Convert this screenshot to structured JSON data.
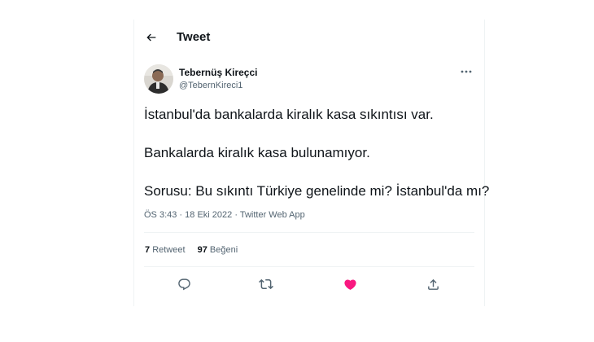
{
  "header": {
    "title": "Tweet",
    "back_icon": "arrow-left-icon"
  },
  "author": {
    "name": "Tebernüş Kireçci",
    "handle": "@TebernKireci1",
    "avatar": "profile-photo"
  },
  "tweet": {
    "lines": [
      "İstanbul'da bankalarda kiralık kasa sıkıntısı var.",
      "Bankalarda kiralık kasa bulunamıyor.",
      "Sorusu: Bu sıkıntı Türkiye genelinde mi? İstanbul'da mı?"
    ],
    "time": "ÖS 3:43",
    "separator": "·",
    "date": "18 Eki 2022",
    "source": "Twitter Web App"
  },
  "stats": {
    "retweets_count": "7",
    "retweets_label": "Retweet",
    "likes_count": "97",
    "likes_label": "Beğeni"
  },
  "actions": {
    "reply_icon": "reply-icon",
    "retweet_icon": "retweet-icon",
    "like_icon": "heart-filled-icon",
    "share_icon": "share-icon"
  },
  "colors": {
    "text": "#0f1419",
    "secondary": "#536471",
    "like": "#f91880",
    "border": "#eff3f4"
  }
}
